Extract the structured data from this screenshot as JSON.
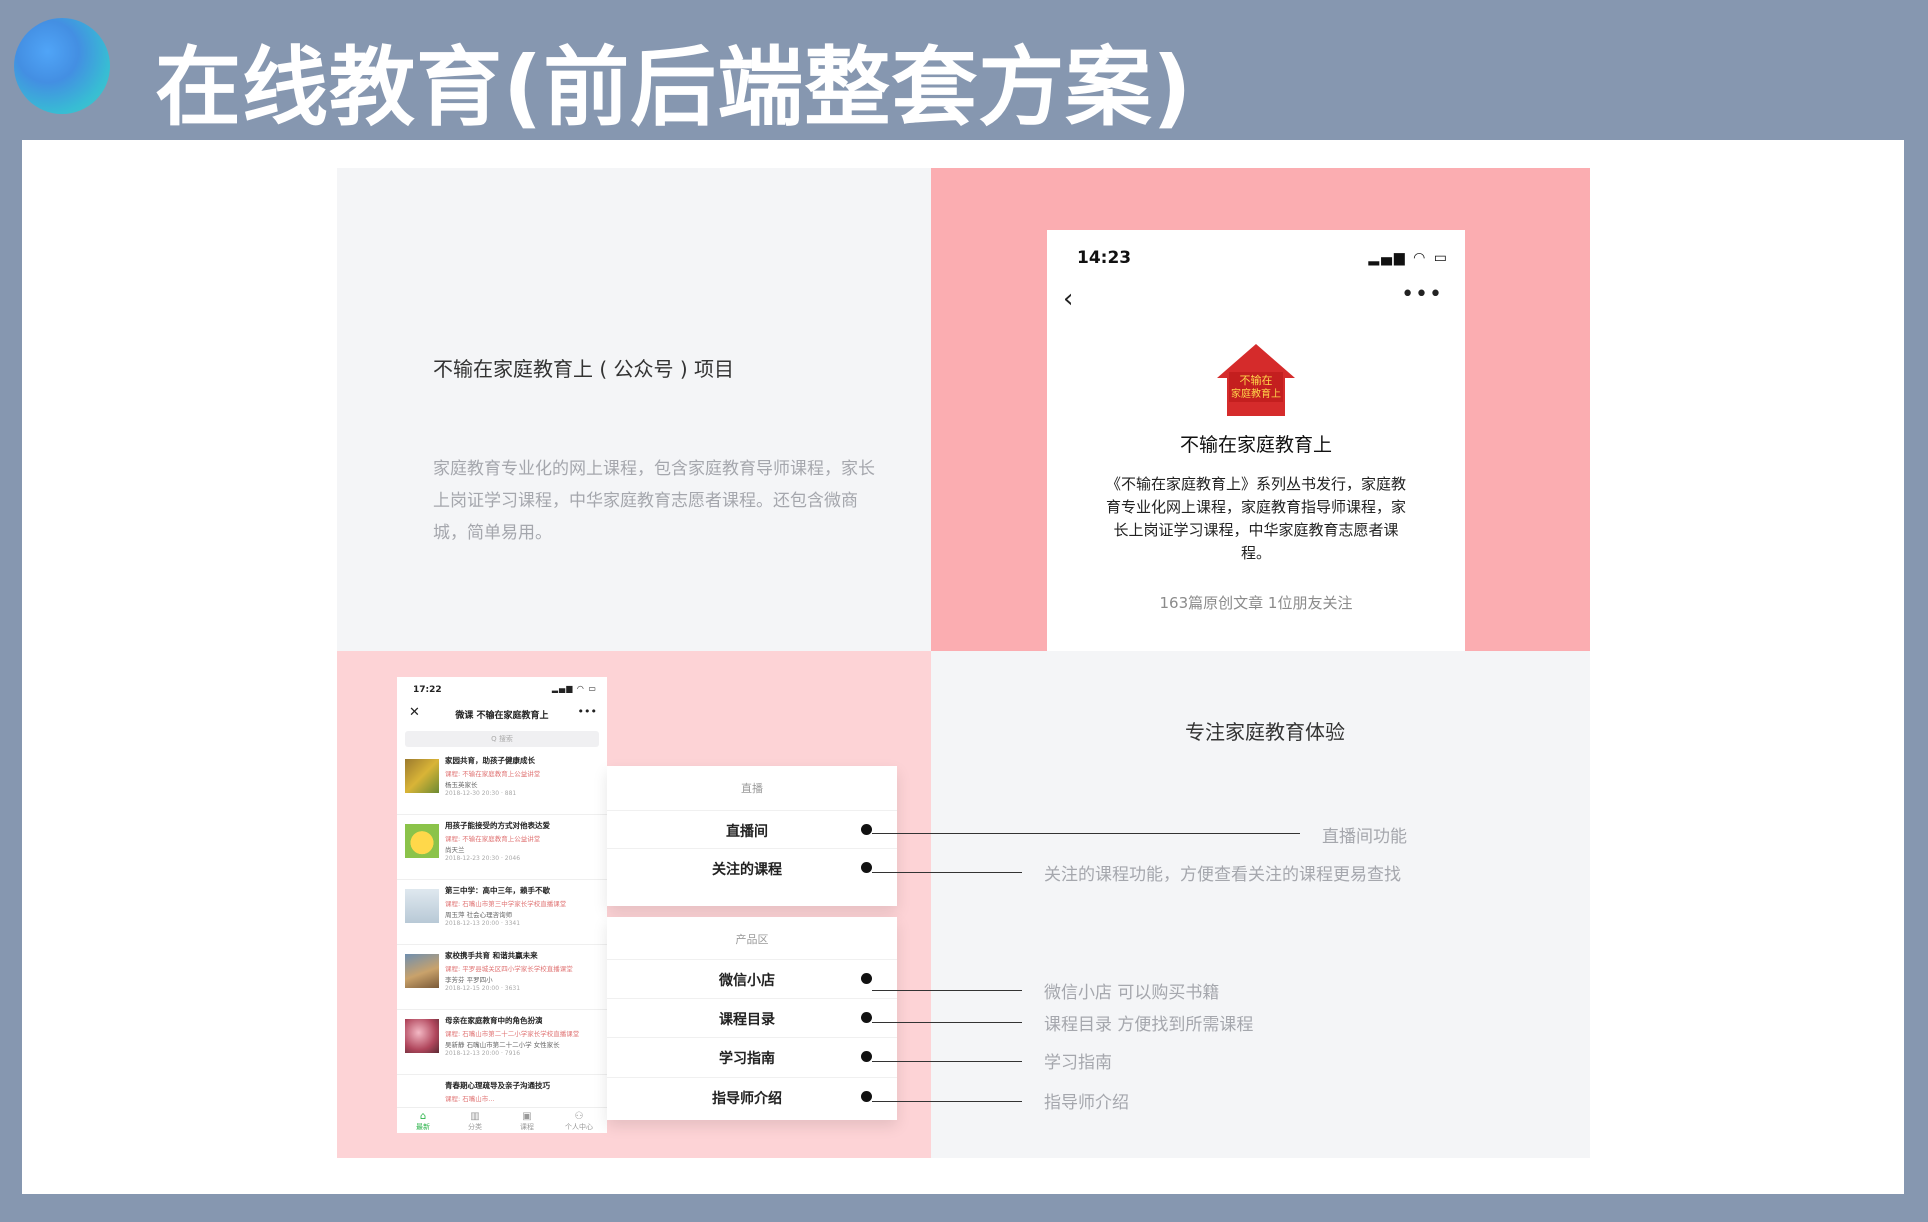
{
  "slide_title": "在线教育(前后端整套方案)",
  "section_tl": {
    "title": "不输在家庭教育上 ( 公众号 ) 项目",
    "description": "家庭教育专业化的网上课程，包含家庭教育导师课程，家长上岗证学习课程，中华家庭教育志愿者课程。还包含微商城，简单易用。"
  },
  "profile_phone": {
    "time": "14:23",
    "status_icons": "signal-wifi-battery",
    "logo_text_1": "不输在",
    "logo_text_2": "家庭教育上",
    "account_name": "不输在家庭教育上",
    "description": "《不输在家庭教育上》系列丛书发行，家庭教育专业化网上课程，家庭教育指导师课程，家长上岗证学习课程，中华家庭教育志愿者课程。",
    "stats": "163篇原创文章  1位朋友关注"
  },
  "list_phone": {
    "time": "17:22",
    "title": "微课 不输在家庭教育上",
    "search_placeholder": "Q 搜索",
    "items": [
      {
        "title": "家园共育，助孩子健康成长",
        "course": "课程: 不输在家庭教育上公益讲堂",
        "author": "杨玉英家长",
        "date": "2018-12-30 20:30 · 881"
      },
      {
        "title": "用孩子能接受的方式对他表达爱",
        "course": "课程: 不输在家庭教育上公益讲堂",
        "author": "尚天兰",
        "date": "2018-12-23 20:30 · 2046"
      },
      {
        "title": "第三中学：高中三年，赖手不歇",
        "course": "课程: 石嘴山市第三中学家长学校直播课堂",
        "author": "周玉萍 社会心理咨询师",
        "date": "2018-12-13 20:00 · 3341"
      },
      {
        "title": "家校携手共育 和谐共赢未来",
        "course": "课程: 平罗县城关区四小学家长学校直播课堂",
        "author": "李芳芬 平罗四小",
        "date": "2018-12-15 20:00 · 3631"
      },
      {
        "title": "母亲在家庭教育中的角色扮演",
        "course": "课程: 石嘴山市第二十二小学家长学校直播课堂",
        "author": "吴新静 石嘴山市第二十二小学 女性家长",
        "date": "2018-12-13 20:00 · 7916"
      },
      {
        "title": "青春期心理疏导及亲子沟通技巧",
        "course": "课程: 石嘴山市...",
        "author": "",
        "date": ""
      }
    ],
    "tabs": [
      {
        "icon": "⌂",
        "label": "最新"
      },
      {
        "icon": "▥",
        "label": "分类"
      },
      {
        "icon": "▣",
        "label": "课程"
      },
      {
        "icon": "⚇",
        "label": "个人中心"
      }
    ]
  },
  "menu_live": {
    "header": "直播",
    "items": [
      "直播间",
      "关注的课程"
    ]
  },
  "menu_products": {
    "header": "产品区",
    "items": [
      "微信小店",
      "课程目录",
      "学习指南",
      "指导师介绍"
    ]
  },
  "section_br": {
    "title": "专注家庭教育体验",
    "annotations": [
      "直播间功能",
      "关注的课程功能，方便查看关注的课程更易查找",
      "微信小店   可以购买书籍",
      "课程目录   方便找到所需课程",
      "学习指南",
      "指导师介绍"
    ]
  },
  "colors": {
    "background": "#8697b0",
    "pink_top": "#fbadb1",
    "pink_bottom": "#fdd3d6",
    "accent_green": "#2bb34a",
    "logo_red": "#d52b2b"
  }
}
